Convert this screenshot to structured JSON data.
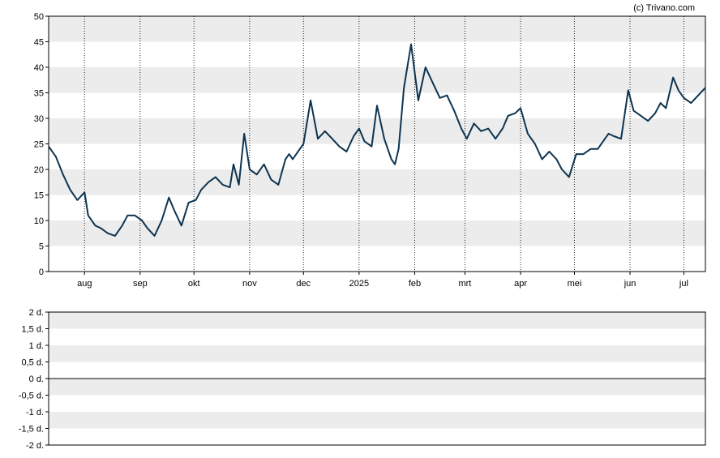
{
  "credit": "(c) Trivano.com",
  "colors": {
    "line": "#0d3450",
    "band": "#ececec",
    "axis": "#000000",
    "plot_bg": "#ffffff"
  },
  "chart_data": [
    {
      "type": "line",
      "title": "",
      "xlabel": "",
      "ylabel": "",
      "ylim": [
        0,
        50
      ],
      "grid": "horizontal bands every 5, dotted vertical month lines",
      "y_ticks": [
        "0",
        "5",
        "10",
        "15",
        "20",
        "25",
        "30",
        "35",
        "40",
        "45",
        "50"
      ],
      "x_ticks": [
        "aug",
        "sep",
        "okt",
        "nov",
        "dec",
        "2025",
        "feb",
        "mrt",
        "apr",
        "mei",
        "jun",
        "jul"
      ],
      "x_tick_dates": [
        "2024-08-01",
        "2024-09-01",
        "2024-10-01",
        "2024-11-01",
        "2024-12-01",
        "2025-01-01",
        "2025-02-01",
        "2025-03-01",
        "2025-04-01",
        "2025-05-01",
        "2025-06-01",
        "2025-07-01"
      ],
      "xlim": [
        "2024-07-12",
        "2025-07-13"
      ],
      "series": [
        {
          "x": [
            "2024-07-12",
            "2024-07-16",
            "2024-07-20",
            "2024-07-24",
            "2024-07-28",
            "2024-08-01",
            "2024-08-03",
            "2024-08-07",
            "2024-08-10",
            "2024-08-14",
            "2024-08-18",
            "2024-08-22",
            "2024-08-25",
            "2024-08-29",
            "2024-09-02",
            "2024-09-05",
            "2024-09-09",
            "2024-09-13",
            "2024-09-17",
            "2024-09-20",
            "2024-09-24",
            "2024-09-28",
            "2024-10-02",
            "2024-10-05",
            "2024-10-09",
            "2024-10-13",
            "2024-10-17",
            "2024-10-21",
            "2024-10-23",
            "2024-10-26",
            "2024-10-29",
            "2024-11-01",
            "2024-11-05",
            "2024-11-09",
            "2024-11-13",
            "2024-11-17",
            "2024-11-21",
            "2024-11-23",
            "2024-11-25",
            "2024-11-29",
            "2024-12-01",
            "2024-12-05",
            "2024-12-09",
            "2024-12-13",
            "2024-12-17",
            "2024-12-21",
            "2024-12-25",
            "2024-12-29",
            "2025-01-01",
            "2025-01-04",
            "2025-01-08",
            "2025-01-11",
            "2025-01-15",
            "2025-01-19",
            "2025-01-21",
            "2025-01-23",
            "2025-01-26",
            "2025-01-30",
            "2025-02-03",
            "2025-02-07",
            "2025-02-11",
            "2025-02-15",
            "2025-02-19",
            "2025-02-23",
            "2025-02-27",
            "2025-03-02",
            "2025-03-06",
            "2025-03-10",
            "2025-03-14",
            "2025-03-18",
            "2025-03-22",
            "2025-03-25",
            "2025-03-29",
            "2025-04-01",
            "2025-04-05",
            "2025-04-09",
            "2025-04-13",
            "2025-04-17",
            "2025-04-21",
            "2025-04-24",
            "2025-04-28",
            "2025-05-02",
            "2025-05-06",
            "2025-05-10",
            "2025-05-14",
            "2025-05-18",
            "2025-05-20",
            "2025-05-23",
            "2025-05-27",
            "2025-05-31",
            "2025-06-03",
            "2025-06-07",
            "2025-06-11",
            "2025-06-15",
            "2025-06-18",
            "2025-06-21",
            "2025-06-25",
            "2025-06-28",
            "2025-07-01",
            "2025-07-05",
            "2025-07-09",
            "2025-07-13"
          ],
          "values": [
            24.5,
            22.5,
            19,
            16,
            14,
            15.5,
            11,
            9,
            8.5,
            7.5,
            7,
            9,
            11,
            11,
            10,
            8.5,
            7,
            10,
            14.5,
            12,
            9,
            13.5,
            14,
            16,
            17.5,
            18.5,
            17,
            16.5,
            21,
            17,
            27,
            20,
            19,
            21,
            18,
            17,
            22,
            23,
            22,
            24,
            25,
            33.5,
            26,
            27.5,
            26,
            24.5,
            23.5,
            26.5,
            28,
            25.5,
            24.5,
            32.5,
            26,
            22,
            21,
            24,
            36,
            44.5,
            33.5,
            40,
            37,
            34,
            34.5,
            31.5,
            28,
            26,
            29,
            27.5,
            28,
            26,
            28,
            30.5,
            31,
            32,
            27,
            25,
            22,
            23.5,
            22,
            20,
            18.5,
            23,
            23,
            24,
            24,
            26,
            27,
            26.5,
            26,
            35.5,
            31.5,
            30.5,
            29.5,
            31,
            33,
            32,
            38,
            35.5,
            34,
            33,
            34.5,
            36
          ]
        }
      ]
    },
    {
      "type": "line",
      "title": "",
      "xlabel": "",
      "ylabel": "",
      "ylim": [
        -2,
        2
      ],
      "y_ticks": [
        "2 d.",
        "1,5 d.",
        "1 d.",
        "0,5 d.",
        "0 d.",
        "-0,5 d.",
        "-1 d.",
        "-1,5 d.",
        "-2 d."
      ],
      "y_tick_values": [
        2,
        1.5,
        1,
        0.5,
        0,
        -0.5,
        -1,
        -1.5,
        -2
      ],
      "series": []
    }
  ]
}
